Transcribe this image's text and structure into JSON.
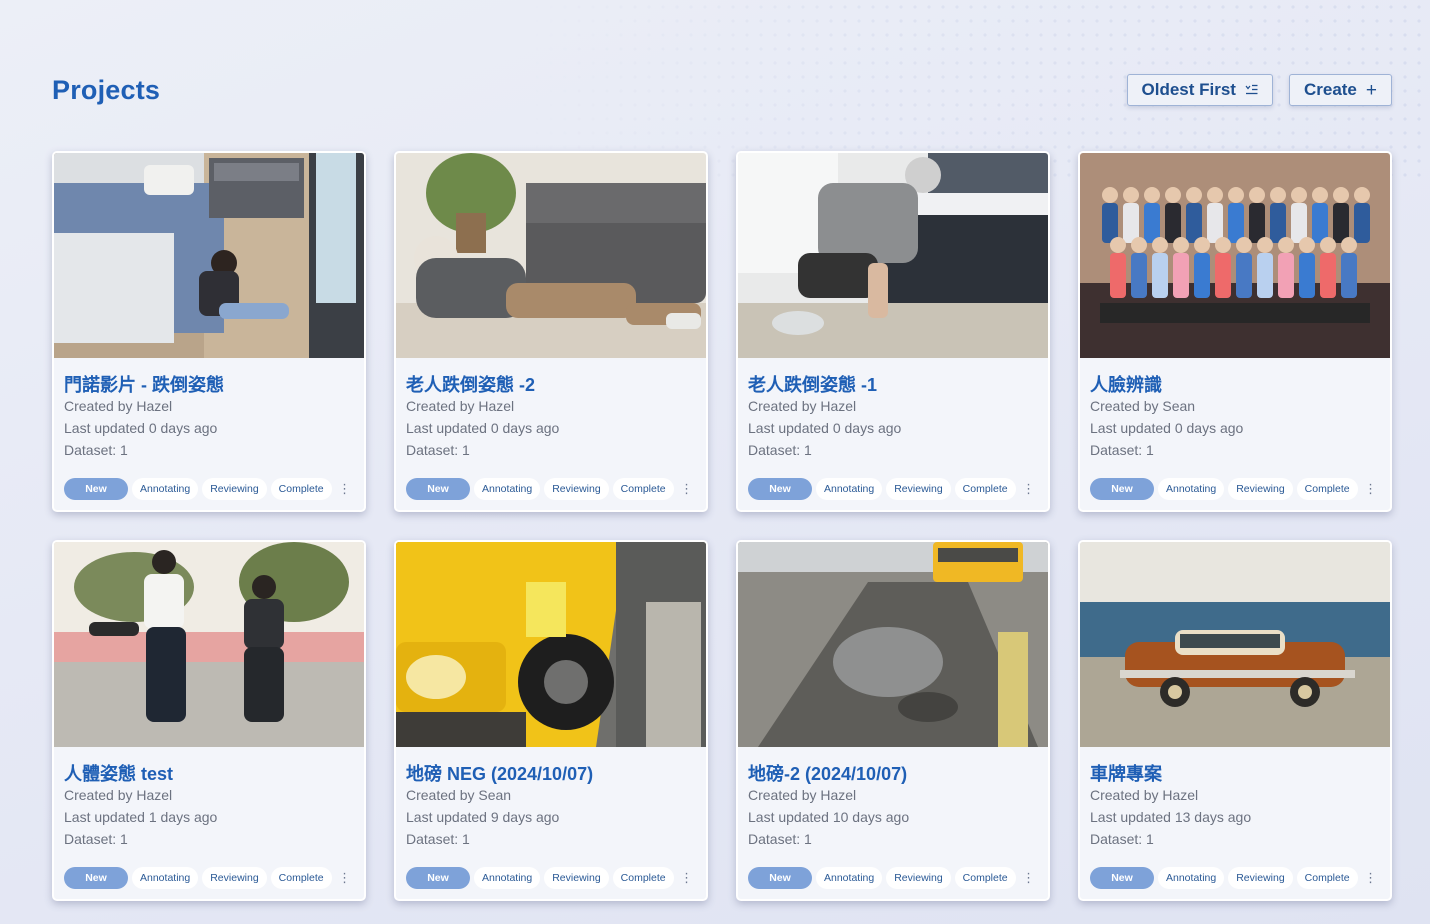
{
  "page": {
    "title": "Projects",
    "sort_label": "Oldest First",
    "sort_icon": "sort-list-icon",
    "create_label": "Create",
    "create_icon": "plus-icon"
  },
  "status_labels": [
    "New",
    "Annotating",
    "Reviewing",
    "Complete"
  ],
  "projects": [
    {
      "title": "門諾影片 - 跌倒姿態",
      "created": "Created by Hazel",
      "updated": "Last updated 0 days ago",
      "dataset": "Dataset: 1",
      "status": "New",
      "thumbnail": "bedroom-fall-photo"
    },
    {
      "title": "老人跌倒姿態 -2",
      "created": "Created by Hazel",
      "updated": "Last updated 0 days ago",
      "dataset": "Dataset: 1",
      "status": "New",
      "thumbnail": "elder-on-floor-photo"
    },
    {
      "title": "老人跌倒姿態 -1",
      "created": "Created by Hazel",
      "updated": "Last updated 0 days ago",
      "dataset": "Dataset: 1",
      "status": "New",
      "thumbnail": "elder-kneeling-photo"
    },
    {
      "title": "人臉辨識",
      "created": "Created by Sean",
      "updated": "Last updated 0 days ago",
      "dataset": "Dataset: 1",
      "status": "New",
      "thumbnail": "group-photo"
    },
    {
      "title": "人體姿態 test",
      "created": "Created by Hazel",
      "updated": "Last updated 1 days ago",
      "dataset": "Dataset: 1",
      "status": "New",
      "thumbnail": "skateboard-friends-photo"
    },
    {
      "title": "地磅 NEG (2024/10/07)",
      "created": "Created by Sean",
      "updated": "Last updated 9 days ago",
      "dataset": "Dataset: 1",
      "status": "New",
      "thumbnail": "yellow-truck-photo"
    },
    {
      "title": "地磅-2 (2024/10/07)",
      "created": "Created by Hazel",
      "updated": "Last updated 10 days ago",
      "dataset": "Dataset: 1",
      "status": "New",
      "thumbnail": "wet-weighbridge-photo"
    },
    {
      "title": "車牌專案",
      "created": "Created by Hazel",
      "updated": "Last updated 13 days ago",
      "dataset": "Dataset: 1",
      "status": "New",
      "thumbnail": "classic-car-photo"
    }
  ],
  "colors": {
    "accent": "#1f5fb5",
    "active_pill": "#7ea2d9"
  }
}
